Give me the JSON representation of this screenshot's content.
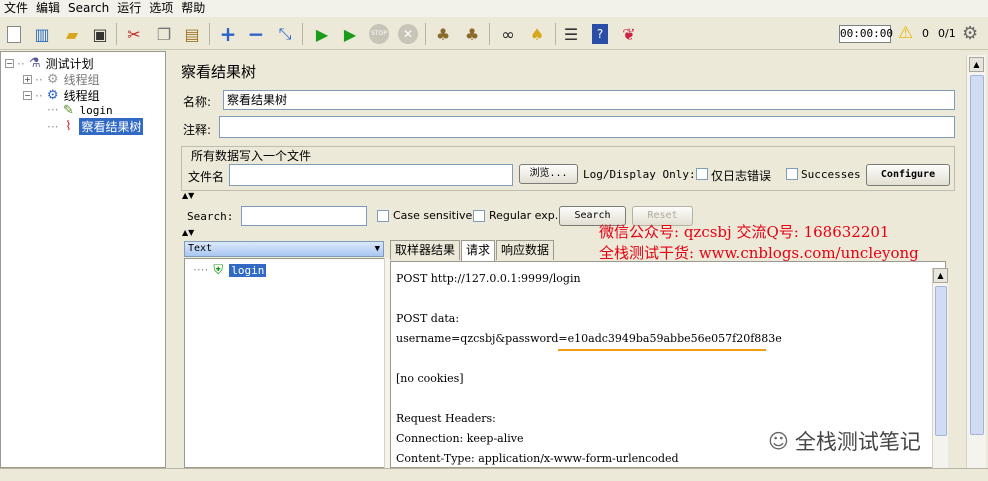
{
  "menu": [
    "文件",
    "编辑",
    "Search",
    "运行",
    "选项",
    "帮助"
  ],
  "toolbar": {
    "timer": "00:00:00",
    "warning_count": "0",
    "threads": "0/1"
  },
  "tree": {
    "root": "测试计划",
    "groups": [
      "线程组",
      "线程组"
    ],
    "children": [
      "login",
      "察看结果树"
    ]
  },
  "panel": {
    "title": "察看结果树",
    "name_label": "名称:",
    "name_value": "察看结果树",
    "comment_label": "注释:",
    "file_section": "所有数据写入一个文件",
    "file_label": "文件名",
    "browse": "浏览...",
    "log_only": "Log/Display Only:",
    "errors_only": "仅日志错误",
    "successes": "Successes",
    "configure": "Configure"
  },
  "search": {
    "label": "Search:",
    "case_sensitive": "Case sensitive",
    "regex": "Regular exp.",
    "search_btn": "Search",
    "reset_btn": "Reset"
  },
  "results": {
    "renderer": "Text",
    "samples": [
      "login"
    ],
    "tabs": [
      "取样器结果",
      "请求",
      "响应数据"
    ],
    "active_tab": 1,
    "content": [
      "POST http://127.0.0.1:9999/login",
      "",
      "POST data:",
      "username=qzcsbj&password=e10adc3949ba59abbe56e057f20f883e",
      "",
      "[no cookies]",
      "",
      "Request Headers:",
      "Connection: keep-alive",
      "Content-Type: application/x-www-form-urlencoded"
    ]
  },
  "watermark": {
    "line1": "微信公众号: qzcsbj   交流Q号: 168632201",
    "line2": "全栈测试干货: www.cnblogs.com/uncleyong",
    "wechat": "全栈测试笔记"
  },
  "colors": {
    "selection": "#316ac5",
    "watermark": "#e60012",
    "underline": "#f39c12"
  }
}
